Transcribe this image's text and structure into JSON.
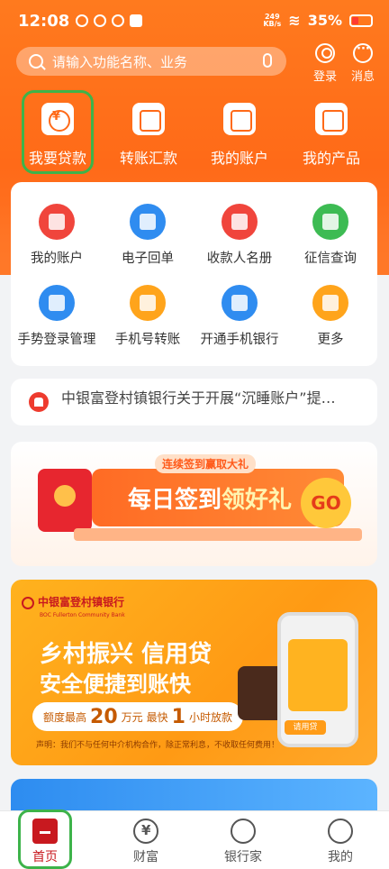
{
  "status": {
    "time": "12:08",
    "net_speed": "249",
    "net_unit": "KB/s",
    "battery": "35%"
  },
  "search": {
    "placeholder": "请输入功能名称、业务"
  },
  "top_actions": {
    "login": "登录",
    "message": "消息"
  },
  "quick": [
    {
      "label": "我要贷款",
      "icon": "loan-icon"
    },
    {
      "label": "转账汇款",
      "icon": "transfer-icon"
    },
    {
      "label": "我的账户",
      "icon": "account-icon"
    },
    {
      "label": "我的产品",
      "icon": "products-icon"
    }
  ],
  "grid": [
    {
      "label": "我的账户",
      "icon": "wallet-icon",
      "color": "#f0453c"
    },
    {
      "label": "电子回单",
      "icon": "receipt-icon",
      "color": "#2f8cf0"
    },
    {
      "label": "收款人名册",
      "icon": "contacts-icon",
      "color": "#f0453c"
    },
    {
      "label": "征信查询",
      "icon": "credit-icon",
      "color": "#3dbb53"
    },
    {
      "label": "手势登录管理",
      "icon": "shield-icon",
      "color": "#2f8cf0"
    },
    {
      "label": "手机号转账",
      "icon": "phone-transfer-icon",
      "color": "#ffa41b"
    },
    {
      "label": "开通手机银行",
      "icon": "mobile-bank-icon",
      "color": "#2f8cf0"
    },
    {
      "label": "更多",
      "icon": "more-grid-icon",
      "color": "#ffa41b"
    }
  ],
  "notice": {
    "text": "中银富登村镇银行关于开展“沉睡账户”提…"
  },
  "banner1": {
    "tag": "连续签到赢取大礼",
    "title_a": "每日签到",
    "title_b": "领好礼",
    "go": "GO"
  },
  "banner2": {
    "brand": "中银富登村镇银行",
    "brand_en": "BOC Fullerton Community Bank",
    "line1": "乡村振兴 信用贷",
    "line2": "安全便捷到账快",
    "amount_prefix": "额度最高",
    "amount": "20",
    "amount_unit": "万元",
    "fast_prefix": "最快",
    "fast": "1",
    "fast_unit": "小时放款",
    "phone_btn": "请用贷",
    "note": "声明：我们不与任何中介机构合作，除正常利息，不收取任何费用！"
  },
  "tabs": [
    {
      "label": "首页",
      "icon": "home-icon"
    },
    {
      "label": "财富",
      "icon": "wealth-icon"
    },
    {
      "label": "银行家",
      "icon": "banker-icon"
    },
    {
      "label": "我的",
      "icon": "profile-icon"
    }
  ]
}
